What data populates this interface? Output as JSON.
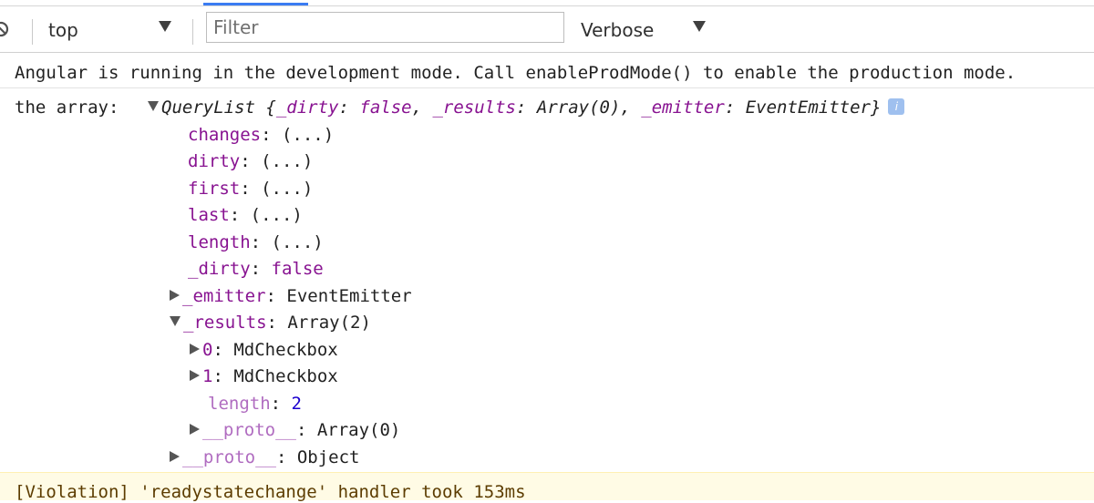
{
  "toolbar": {
    "clear_icon": "clear-console-icon",
    "context_value": "top",
    "filter_placeholder": "Filter",
    "level_value": "Verbose"
  },
  "messages": {
    "angular": "Angular is running in the development mode. Call enableProdMode() to enable the production mode.",
    "array_label": "the array:",
    "querylist": {
      "type": "QueryList",
      "open": "{",
      "k_dirty": "_dirty",
      "v_dirty": "false",
      "k_results": "_results",
      "v_results": "Array(0)",
      "k_emitter": "_emitter",
      "v_emitter": "EventEmitter",
      "close": "}",
      "info_icon": "i"
    },
    "props": {
      "changes": "changes",
      "dirty": "dirty",
      "first": "first",
      "last": "last",
      "length": "length",
      "getter": "(...)",
      "_dirty_key": "_dirty",
      "_dirty_val": "false",
      "_emitter_key": "_emitter",
      "_emitter_val": "EventEmitter",
      "_results_key": "_results",
      "_results_val": "Array(2)"
    },
    "results": {
      "i0": "0",
      "i0_val": "MdCheckbox",
      "i1": "1",
      "i1_val": "MdCheckbox",
      "length_key": "length",
      "length_val": "2",
      "proto_key": "__proto__",
      "proto_val": "Array(0)"
    },
    "outer_proto_key": "__proto__",
    "outer_proto_val": "Object",
    "violation": "[Violation] 'readystatechange' handler took 153ms"
  }
}
